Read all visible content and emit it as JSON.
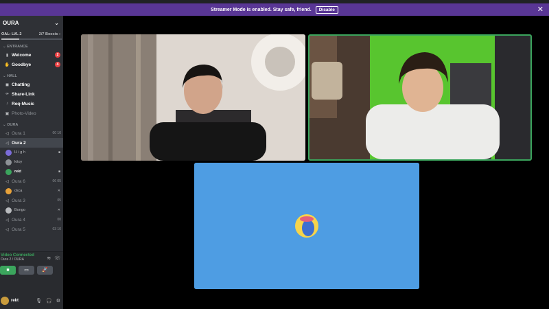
{
  "banner": {
    "text": "Streamer Mode is enabled. Stay safe, friend.",
    "button": "Disable",
    "close": "✕"
  },
  "server": {
    "name": "OURA",
    "goal": "OAL: LVL 2",
    "boosts": "2/7 Boosts",
    "boost_progress": 0.29
  },
  "categories": {
    "entrance": "ENTRANCE",
    "hall": "HALL",
    "oura": "OURA"
  },
  "channels": {
    "welcome": {
      "label": "Welcome",
      "badge": "2"
    },
    "goodbye": {
      "label": "Goodbye",
      "badge": "4"
    },
    "chatting": {
      "label": "Chatting"
    },
    "share_link": {
      "label": "Share-Link"
    },
    "req_music": {
      "label": "Req-Music"
    },
    "photo_video": {
      "label": "Photo-Video"
    },
    "oura1": {
      "label": "Oura 1",
      "meta": "00 10"
    },
    "oura2": {
      "label": "Oura 2"
    },
    "oura6": {
      "label": "Oura 6",
      "meta": "06 05"
    },
    "oura3": {
      "label": "Oura 3",
      "meta": "05"
    },
    "oura4": {
      "label": "Oura 4",
      "meta": "00"
    },
    "oura5": {
      "label": "Oura 5",
      "meta": "03 10"
    }
  },
  "voice_users": {
    "u1": "H i g h",
    "u2": "kitoy",
    "u3": "rekt",
    "u4": "ckca",
    "u5": "Bongo"
  },
  "voice": {
    "status": "Video Connected",
    "where": "Oura 2 / OURA"
  },
  "user": {
    "name": "rekt"
  },
  "colors": {
    "banner": "#593695",
    "sidebar": "#2f3136",
    "connected": "#3ba55d",
    "tile_empty": "#4e9de3"
  }
}
